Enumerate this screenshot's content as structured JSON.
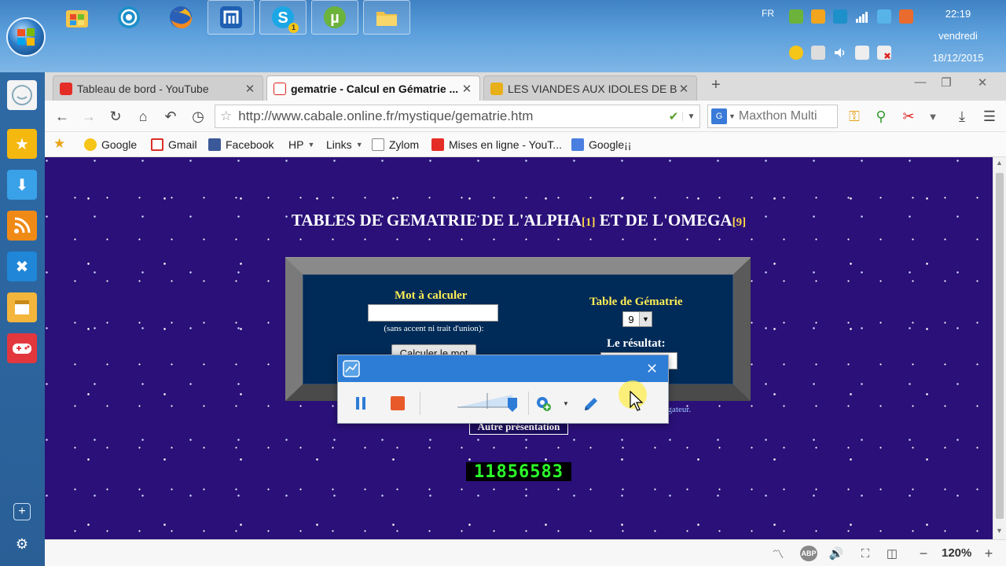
{
  "taskbar": {
    "language": "FR",
    "clock_time": "22:19",
    "clock_day": "vendredi",
    "clock_date": "18/12/2015",
    "pinned_apps": [
      "windows-store-icon",
      "speaker-settings-icon",
      "firefox-icon",
      "maxthon-icon",
      "skype-icon",
      "utorrent-icon",
      "file-explorer-icon"
    ],
    "skype_badge": "1"
  },
  "browser": {
    "tabs": [
      {
        "title": "Tableau de bord - YouTube",
        "favicon_color": "#e52d27",
        "active": false
      },
      {
        "title": "gematrie - Calcul en Gématrie ...",
        "favicon_color": "#d9261c",
        "active": true
      },
      {
        "title": "LES VIANDES AUX IDOLES DE B...",
        "favicon_color": "#e8b018",
        "active": false
      }
    ],
    "new_tab": "+",
    "close_tab": "✕",
    "address": "http://www.cabale.online.fr/mystique/gematrie.htm",
    "search_placeholder": "Maxthon Multi",
    "bookmarks": [
      {
        "label": "Google",
        "icon": "sun-icon",
        "dropdown": false
      },
      {
        "label": "Gmail",
        "icon": "gmail-icon",
        "dropdown": false
      },
      {
        "label": "Facebook",
        "icon": "facebook-icon",
        "dropdown": false
      },
      {
        "label": "HP",
        "icon": "",
        "dropdown": true
      },
      {
        "label": "Links",
        "icon": "",
        "dropdown": true
      },
      {
        "label": "Zylom",
        "icon": "page-icon",
        "dropdown": false
      },
      {
        "label": "Mises en ligne - YouT...",
        "icon": "youtube-icon",
        "dropdown": false
      },
      {
        "label": "Google¡¡",
        "icon": "google-icon",
        "dropdown": false
      }
    ],
    "zoom": "120%"
  },
  "page": {
    "title_part1": "TABLES DE GEMATRIE DE L'ALPHA",
    "ref1": "[1]",
    "title_part2": " ET DE L'OMEGA",
    "ref2": "[9]",
    "word_label": "Mot à calculer",
    "word_value": "",
    "hint": "(sans accent ni trait d'union):",
    "calc_button": "Calculer le mot",
    "table_label": "Table de Gématrie",
    "table_value": "9",
    "result_label": "Le résultat:",
    "result_value": "",
    "other_presentation": "Autre présentation",
    "browser_note": "vigateur.",
    "counter": "11856583"
  },
  "recorder": {
    "close_label": "✕"
  },
  "colors": {
    "page_background": "#2a1078",
    "label_yellow": "#ffee55",
    "counter_green": "#2bff2b",
    "recorder_blue": "#2d7dd6"
  }
}
